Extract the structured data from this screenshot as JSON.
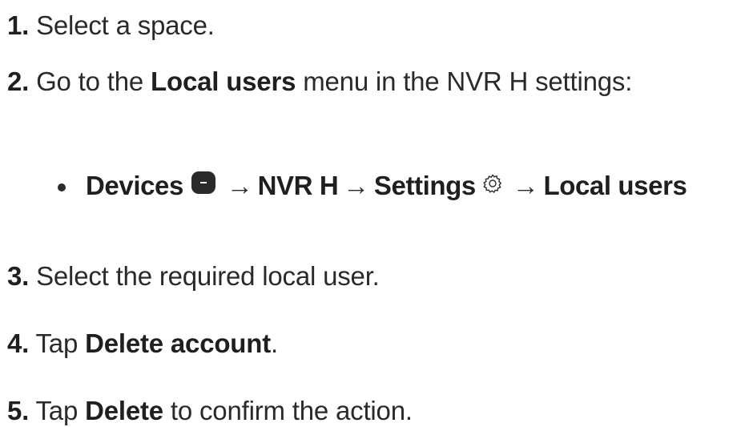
{
  "steps": [
    {
      "num": "1.",
      "text": " Select a space."
    },
    {
      "num": "2.",
      "pre": " Go to the ",
      "bold": "Local users",
      "post": " menu in the NVR H settings:"
    },
    {
      "num": "3.",
      "text": " Select the required local user."
    },
    {
      "num": "4.",
      "pre": " Tap ",
      "bold": "Delete account",
      "post": "."
    },
    {
      "num": "5.",
      "pre": " Tap ",
      "bold": "Delete",
      "post": " to confirm the action."
    }
  ],
  "path": {
    "devices": "Devices",
    "arrow": "→",
    "nvr": "NVR H",
    "settings": "Settings",
    "local_users": "Local users",
    "icons": [
      "devices-icon",
      "gear-icon"
    ]
  }
}
